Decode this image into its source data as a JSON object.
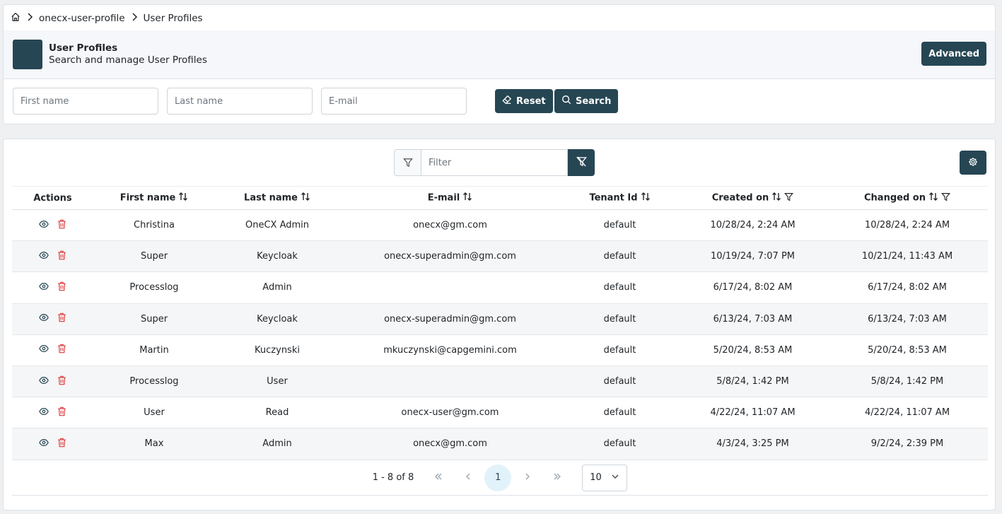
{
  "breadcrumb": {
    "app": "onecx-user-profile",
    "current": "User Profiles"
  },
  "header": {
    "title": "User Profiles",
    "subtitle": "Search and manage User Profiles",
    "advanced_label": "Advanced"
  },
  "criteria": {
    "first_name_placeholder": "First name",
    "last_name_placeholder": "Last name",
    "email_placeholder": "E-mail",
    "reset_label": "Reset",
    "search_label": "Search"
  },
  "table_filter": {
    "placeholder": "Filter"
  },
  "columns": [
    "Actions",
    "First name",
    "Last name",
    "E-mail",
    "Tenant Id",
    "Created on",
    "Changed on"
  ],
  "rows": [
    {
      "first": "Christina",
      "last": "OneCX Admin",
      "email": "onecx@gm.com",
      "tenant": "default",
      "created": "10/28/24, 2:24 AM",
      "changed": "10/28/24, 2:24 AM"
    },
    {
      "first": "Super",
      "last": "Keycloak",
      "email": "onecx-superadmin@gm.com",
      "tenant": "default",
      "created": "10/19/24, 7:07 PM",
      "changed": "10/21/24, 11:43 AM"
    },
    {
      "first": "Processlog",
      "last": "Admin",
      "email": "",
      "tenant": "default",
      "created": "6/17/24, 8:02 AM",
      "changed": "6/17/24, 8:02 AM"
    },
    {
      "first": "Super",
      "last": "Keycloak",
      "email": "onecx-superadmin@gm.com",
      "tenant": "default",
      "created": "6/13/24, 7:03 AM",
      "changed": "6/13/24, 7:03 AM"
    },
    {
      "first": "Martin",
      "last": "Kuczynski",
      "email": "mkuczynski@capgemini.com",
      "tenant": "default",
      "created": "5/20/24, 8:53 AM",
      "changed": "5/20/24, 8:53 AM"
    },
    {
      "first": "Processlog",
      "last": "User",
      "email": "",
      "tenant": "default",
      "created": "5/8/24, 1:42 PM",
      "changed": "5/8/24, 1:42 PM"
    },
    {
      "first": "User",
      "last": "Read",
      "email": "onecx-user@gm.com",
      "tenant": "default",
      "created": "4/22/24, 11:07 AM",
      "changed": "4/22/24, 11:07 AM"
    },
    {
      "first": "Max",
      "last": "Admin",
      "email": "onecx@gm.com",
      "tenant": "default",
      "created": "4/3/24, 3:25 PM",
      "changed": "9/2/24, 2:39 PM"
    }
  ],
  "paginator": {
    "info": "1 - 8 of 8",
    "current_page": "1",
    "rows_per_page": "10"
  },
  "colors": {
    "primary": "#264653",
    "danger": "#d9383a",
    "header_bg": "#f5f7fa"
  }
}
